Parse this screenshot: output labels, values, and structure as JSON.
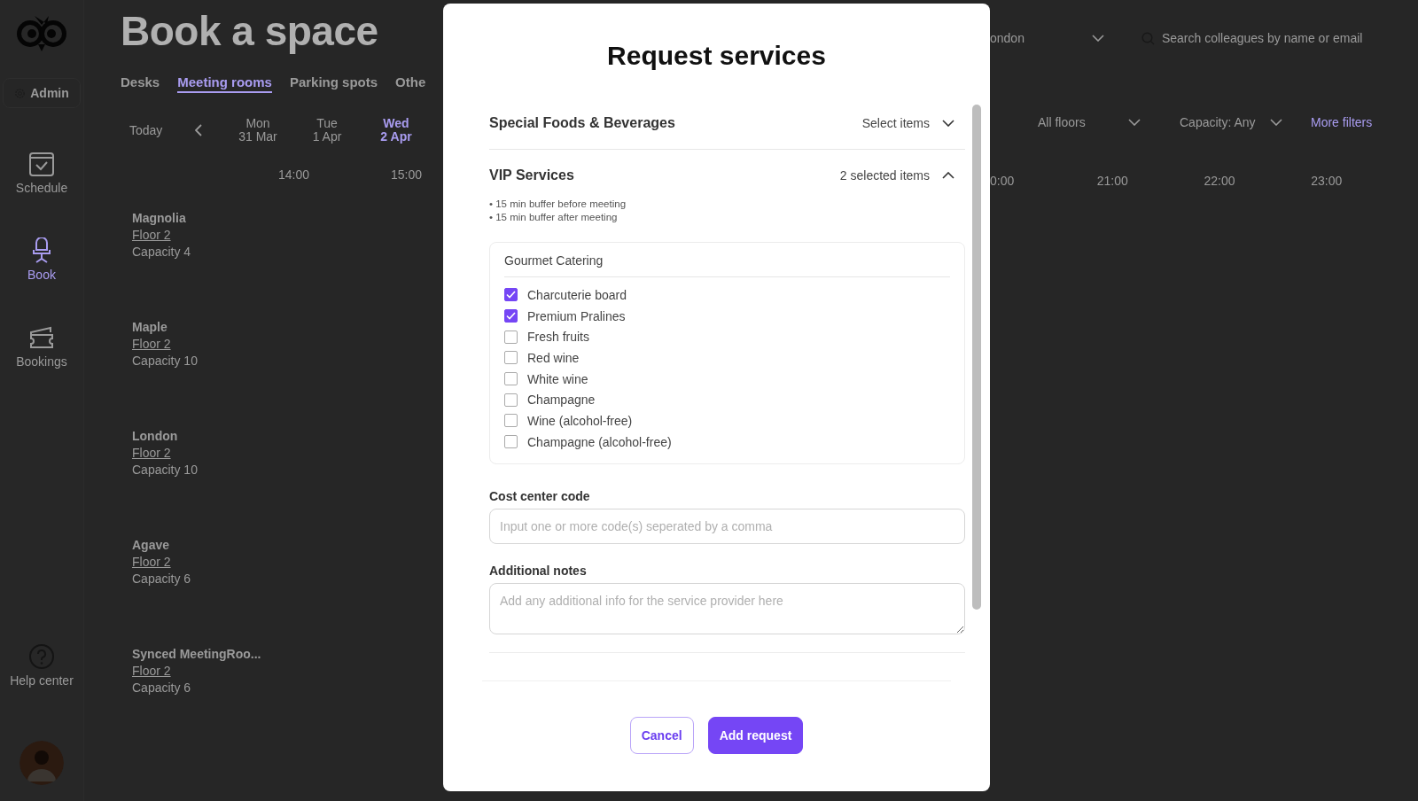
{
  "sidebar": {
    "admin_button": "Admin",
    "items": [
      {
        "label": "Schedule",
        "kind": "schedule",
        "selected": false
      },
      {
        "label": "Book",
        "kind": "book",
        "selected": true
      },
      {
        "label": "Bookings",
        "kind": "bookings",
        "selected": false
      }
    ],
    "help": "Help center"
  },
  "page": {
    "title": "Book a space",
    "tabs": [
      {
        "label": "Desks",
        "selected": false
      },
      {
        "label": "Meeting rooms",
        "selected": true
      },
      {
        "label": "Parking spots",
        "selected": false
      },
      {
        "label": "Othe",
        "selected": false
      }
    ],
    "location": "ondon",
    "search": {
      "placeholder": "Search colleagues by name or email"
    },
    "today": "Today",
    "days": [
      {
        "weekday": "Mon",
        "date": "31 Mar",
        "selected": false
      },
      {
        "weekday": "Tue",
        "date": "1 Apr",
        "selected": false
      },
      {
        "weekday": "Wed",
        "date": "2 Apr",
        "selected": true
      }
    ],
    "filters": [
      "All floors",
      "Capacity: Any"
    ],
    "more_filters": "More filters",
    "times_left": [
      "14:00",
      "15:00"
    ],
    "times_right": [
      "0:00",
      "21:00",
      "22:00",
      "23:00"
    ],
    "rooms": [
      {
        "name": "Magnolia",
        "floor": "Floor 2",
        "capacity": "Capacity 4"
      },
      {
        "name": "Maple",
        "floor": "Floor 2",
        "capacity": "Capacity 10"
      },
      {
        "name": "London",
        "floor": "Floor 2",
        "capacity": "Capacity 10"
      },
      {
        "name": "Agave",
        "floor": "Floor 2",
        "capacity": "Capacity 6"
      },
      {
        "name": "Synced MeetingRoo...",
        "floor": "Floor 2",
        "capacity": "Capacity 6"
      }
    ]
  },
  "dialog": {
    "title": "Request services",
    "sections": [
      {
        "title": "Special Foods & Beverages",
        "summary": "Select items",
        "expanded": false
      },
      {
        "title": "VIP Services",
        "summary": "2 selected items",
        "expanded": true,
        "notes": [
          "• 15 min buffer before meeting",
          "• 15 min buffer after meeting"
        ],
        "group": {
          "title": "Gourmet Catering",
          "options": [
            {
              "label": "Charcuterie board",
              "checked": true
            },
            {
              "label": "Premium Pralines",
              "checked": true
            },
            {
              "label": "Fresh fruits",
              "checked": false
            },
            {
              "label": "Red wine",
              "checked": false
            },
            {
              "label": "White wine",
              "checked": false
            },
            {
              "label": "Champagne",
              "checked": false
            },
            {
              "label": "Wine (alcohol-free)",
              "checked": false
            },
            {
              "label": "Champagne (alcohol-free)",
              "checked": false
            }
          ]
        }
      }
    ],
    "cost_center": {
      "label": "Cost center code",
      "placeholder": "Input one or more code(s) seperated by a comma"
    },
    "notes_field": {
      "label": "Additional notes",
      "placeholder": "Add any additional info for the service provider here"
    },
    "buttons": [
      {
        "label": "Cancel",
        "kind": "secondary"
      },
      {
        "label": "Add request",
        "kind": "primary"
      }
    ]
  }
}
